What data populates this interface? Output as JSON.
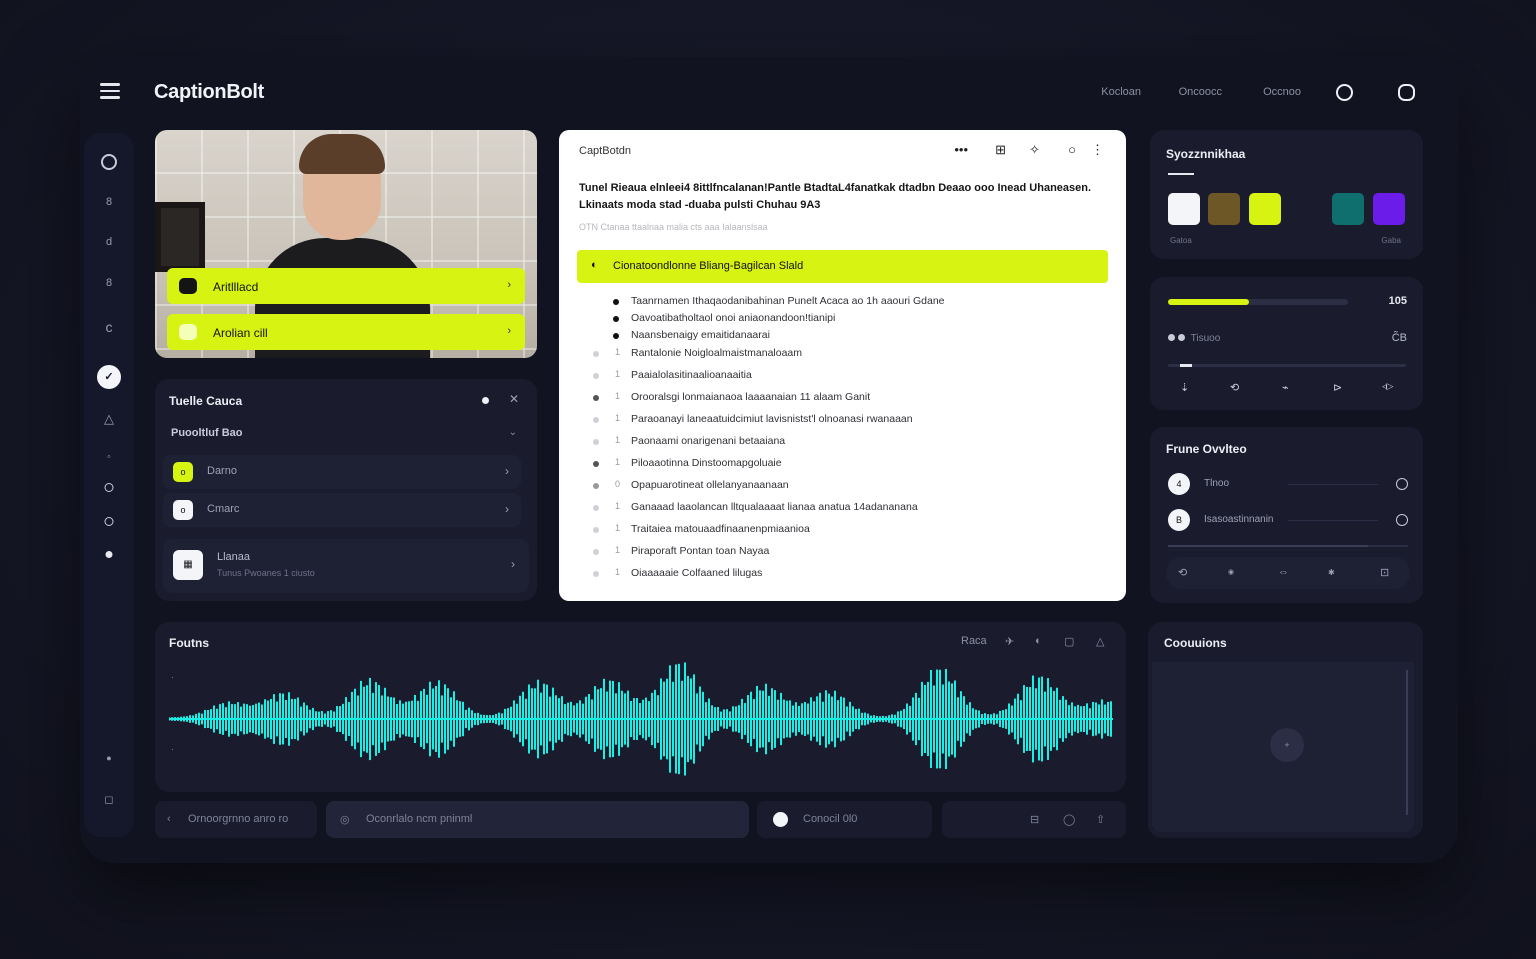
{
  "app": {
    "brand": "CaptionBolt"
  },
  "topnav": {
    "links": [
      "Kocloan",
      "Oncoocc",
      "Occnoo"
    ]
  },
  "rail": {
    "items": [
      "",
      "8",
      "d",
      "8",
      "c",
      "✓",
      "△",
      "◦",
      "",
      "",
      "",
      "●",
      "◻"
    ]
  },
  "video": {
    "buttons": [
      {
        "label": "Aritlllacd",
        "chevron": "›"
      },
      {
        "label": "Arolian cill",
        "chevron": "›"
      }
    ]
  },
  "list_card": {
    "title": "Tuelle Cauca",
    "sub_title": "Puooltluf Bao",
    "sub_chevron": "⌄",
    "close": "✕",
    "items": [
      {
        "icon": "o",
        "label": "Darno",
        "chevron": "›"
      },
      {
        "icon": "o",
        "label": "Cmarc",
        "chevron": "›"
      }
    ],
    "big_item": {
      "icon": "▦",
      "title": "Llanaa",
      "subtitle": "Tunus Pwoanes 1 ciusto",
      "chevron": "›"
    }
  },
  "doc": {
    "title": "CaptBotdn",
    "tools": [
      "•••",
      "⊞",
      "✧",
      "○",
      "⋮"
    ],
    "heading": "Tunel Rieaua elnleei4 8ittlfncalanan!Pantle BtadtaL4fanatkak dtadbn Deaao ooo Inead Uhaneasen. Lkinaats moda stad -duaba pulsti Chuhau 9A3",
    "meta": "OTN  Ctanaa ttaalnaa malia  cts  aaa Ialaanslsaa",
    "highlight_icon": "◐",
    "highlight": "Cionatoondlonne Bliang-Bagilcan Slald",
    "lines": [
      {
        "num": "",
        "text": "Taanrnamen Ithaqaodanibahinan Punelt Acaca ao 1h aaouri Gdane"
      },
      {
        "num": "",
        "text": "Oavoatibatholtaol onoi aniaonandoon!tianipi"
      },
      {
        "num": "",
        "text": "Naansbenaigy emaitidanaarai"
      },
      {
        "num": "1",
        "text": "Rantalonie Noigloalmaistmanaloaam"
      },
      {
        "num": "1",
        "text": "Paaialolasitinaalioanaaitia"
      },
      {
        "num": "1",
        "text": "Orooralsgi lonmaianaoa  laaaanaian 11 alaam Ganit"
      },
      {
        "num": "1",
        "text": "Paraoanayi laneaatuidcimiut lavisnistst'l olnoanasi rwanaaan"
      },
      {
        "num": "1",
        "text": "Paonaami onarigenani betaaiana"
      },
      {
        "num": "1",
        "text": "Piloaaotinna Dinstoomapgoluaie"
      },
      {
        "num": "0",
        "text": "Opapuarotineat  ollelanyanaanaan"
      },
      {
        "num": "1",
        "text": "Ganaaad laaolancan lltqualaaaat lianaa anatua 14adananana"
      },
      {
        "num": "1",
        "text": "Traitaiea matouaadfinaanenpmiaanioa"
      },
      {
        "num": "1",
        "text": "Piraporaft Pontan toan Nayaa"
      },
      {
        "num": "1",
        "text": "Oiaaaaaie Colfaaned lilugas"
      }
    ]
  },
  "swatch_card": {
    "title": "Syozznnikhaa",
    "caption_left": "Gatoa",
    "caption_right": "Gaba",
    "colors": [
      "#f4f5f9",
      "#6e5726",
      "#d7f312",
      "#0f6f6e",
      "#6c1ce8"
    ]
  },
  "playback": {
    "progress": 0.45,
    "value": "105",
    "row_label": "Tisuoo",
    "row_value": "C̃B",
    "slider_position": 0.05,
    "controls": [
      "⇣",
      "⟲",
      "⌁",
      "⊳",
      "◃▷"
    ]
  },
  "devices": {
    "title": "Frune Ovvlteo",
    "rows": [
      {
        "icon": "4",
        "label": "Tlnoo"
      },
      {
        "icon": "B",
        "label": "Isasoastinnanin"
      }
    ],
    "controls": [
      "⟲",
      "◉",
      "⇔",
      "✱",
      "⊡"
    ]
  },
  "waveform": {
    "title": "Foutns",
    "tools": [
      "Raca",
      "✈",
      "◐",
      "▢",
      "△"
    ],
    "color": "#18f0e6"
  },
  "bottom": {
    "left_pill": "Ornoorgrnno anro ro",
    "search_placeholder": "Oconrlalo ncm pninml",
    "status": "Conocil 0l0"
  },
  "captions": {
    "title": "Coouuions",
    "add": "+"
  }
}
